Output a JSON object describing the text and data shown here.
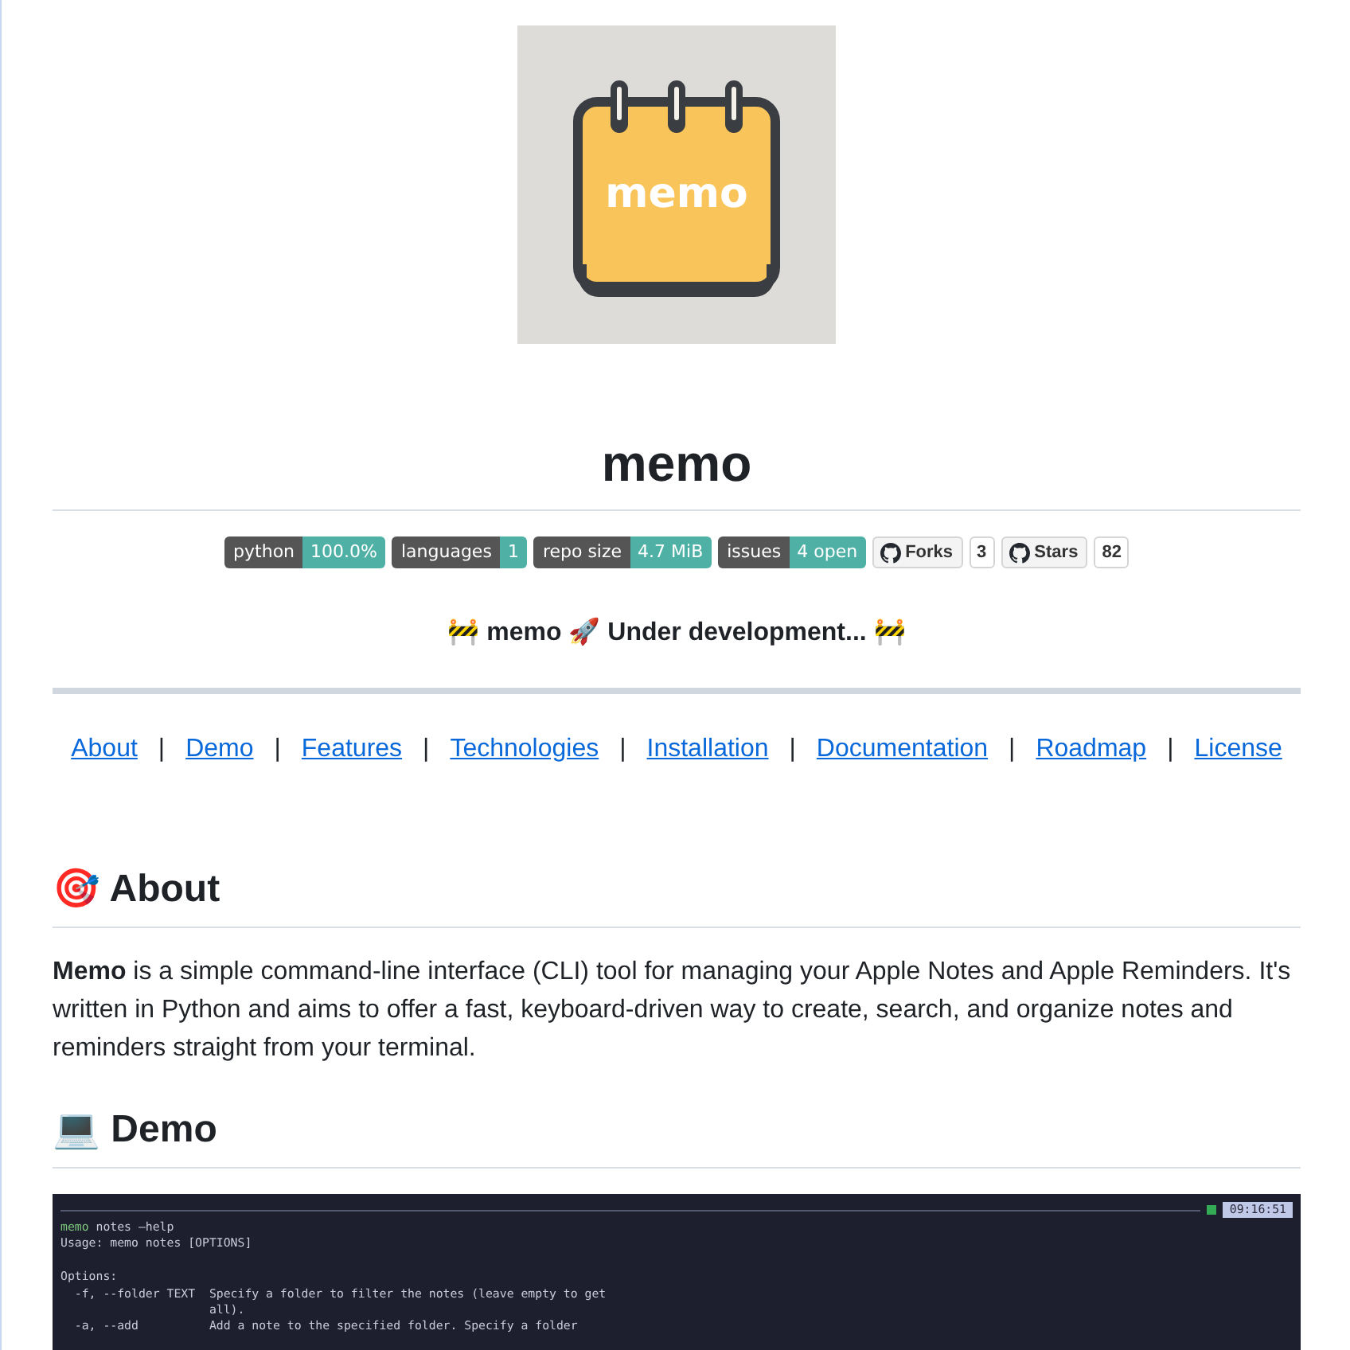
{
  "logo": {
    "text": "memo"
  },
  "title": "memo",
  "badges": [
    {
      "kind": "shield",
      "label": "python",
      "value": "100.0%"
    },
    {
      "kind": "shield",
      "label": "languages",
      "value": "1"
    },
    {
      "kind": "shield",
      "label": "repo size",
      "value": "4.7 MiB"
    },
    {
      "kind": "shield",
      "label": "issues",
      "value": "4 open"
    },
    {
      "kind": "social",
      "label": "Forks",
      "value": "3"
    },
    {
      "kind": "social",
      "label": "Stars",
      "value": "82"
    }
  ],
  "tagline": "🚧 memo 🚀 Under development... 🚧",
  "nav": [
    "About",
    "Demo",
    "Features",
    "Technologies",
    "Installation",
    "Documentation",
    "Roadmap",
    "License"
  ],
  "nav_separator": "|",
  "about": {
    "heading": "🎯 About",
    "text": "**Memo** is a simple command-line interface (CLI) tool for managing your Apple Notes and Apple Reminders. It's written in Python and aims to offer a fast, keyboard-driven way to create, search, and organize notes and reminders straight from your terminal."
  },
  "demo": {
    "heading": "💻 Demo",
    "terminal": {
      "clock": "09:16:51",
      "program": "memo",
      "args": "notes —help",
      "blocks": [
        [
          "Usage: memo notes [OPTIONS]"
        ],
        [
          "Options:",
          "  -f, --folder TEXT  Specify a folder to filter the notes (leave empty to get",
          "                     all).",
          "  -a, --add          Add a note to the specified folder. Specify a folder"
        ]
      ]
    }
  }
}
